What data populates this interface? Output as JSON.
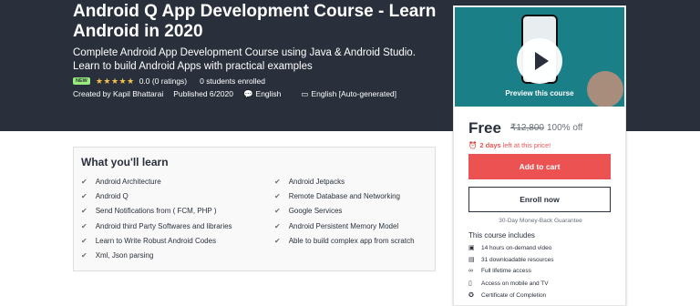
{
  "hero": {
    "title": "Android Q App Development Course - Learn Android in 2020",
    "subtitle": "Complete Android App Development Course using Java & Android Studio. Learn to build Android Apps with practical examples",
    "badge": "NEW",
    "stars": "★★★★★",
    "rating": "0.0 (0 ratings)",
    "students": "0 students enrolled",
    "created_by": "Created by Kapil Bhattarai",
    "published": "Published 6/2020",
    "language": "English",
    "captions": "English [Auto-generated]"
  },
  "learn": {
    "title": "What you'll learn",
    "left": [
      "Android Architecture",
      "Android Q",
      "Send Notifications from ( FCM, PHP )",
      "Android third Party Softwares and libraries",
      "Learn to Write Robust Android Codes",
      "Xml, Json parsing"
    ],
    "right": [
      "Android Jetpacks",
      "Remote Database and Networking",
      "Google Services",
      "Android Persistent Memory Model",
      "Able to build complex app from scratch"
    ]
  },
  "sidebar": {
    "preview_label": "Preview this course",
    "price": "Free",
    "original_price": "₹12,800",
    "discount": "100% off",
    "deadline_bold": "2 days",
    "deadline_rest": "left at this price!",
    "add_to_cart": "Add to cart",
    "enroll_now": "Enroll now",
    "guarantee": "30-Day Money-Back Guarantee",
    "includes_title": "This course includes",
    "includes": [
      {
        "icon": "video-icon",
        "text": "14 hours on-demand video"
      },
      {
        "icon": "file-icon",
        "text": "31 downloadable resources"
      },
      {
        "icon": "infinity-icon",
        "text": "Full lifetime access"
      },
      {
        "icon": "mobile-icon",
        "text": "Access on mobile and TV"
      },
      {
        "icon": "certificate-icon",
        "text": "Certificate of Completion"
      }
    ]
  },
  "colors": {
    "hero_bg": "#29303b",
    "accent_red": "#ec5252",
    "star": "#f4c150",
    "badge_green": "#97ec7b"
  }
}
